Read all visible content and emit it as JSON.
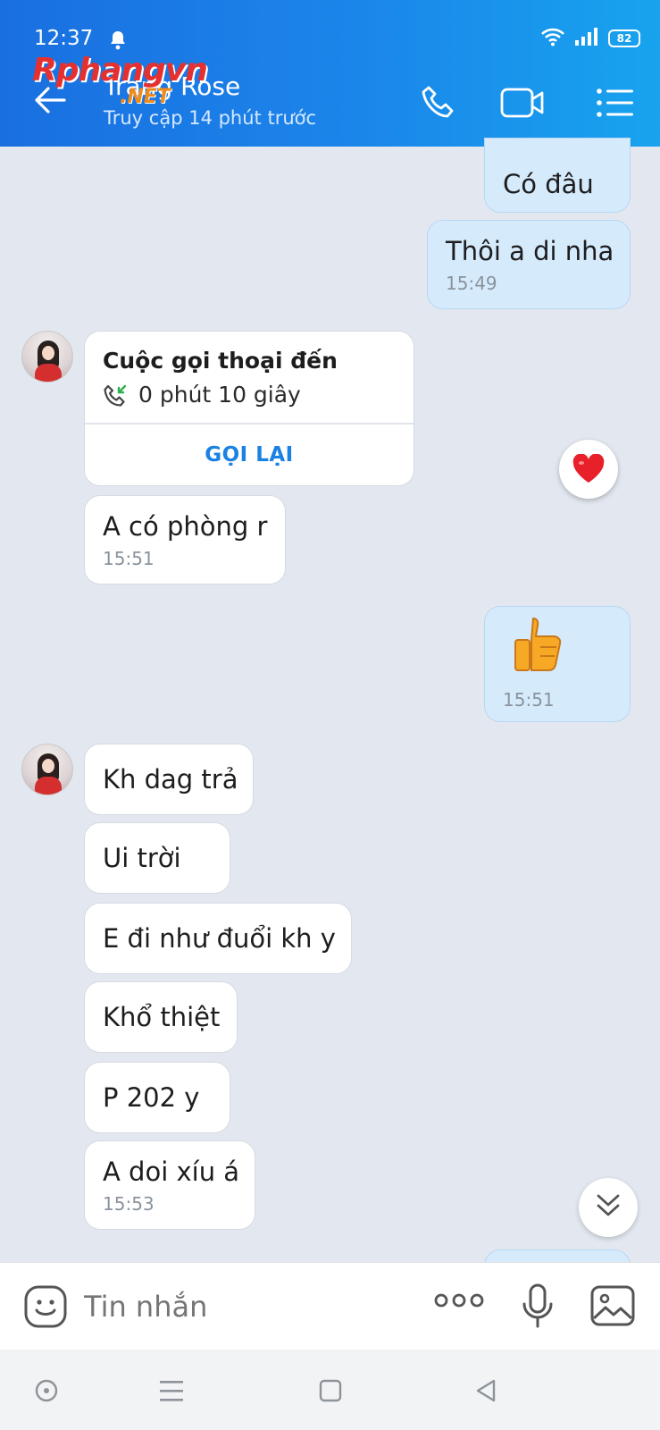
{
  "status_bar": {
    "time": "12:37",
    "battery": "82"
  },
  "header": {
    "contact_name": "Trang Rose",
    "last_seen": "Truy cập 14 phút trước",
    "watermark": "Rphangvn",
    "watermark_sub": ".NET",
    "colors": {
      "gradient_start": "#1a6fe0",
      "gradient_end": "#17a3ee"
    }
  },
  "messages": [
    {
      "sender": "me",
      "text": "Có đâu"
    },
    {
      "sender": "me",
      "text": "Thôi a di nha",
      "time": "15:49"
    },
    {
      "sender": "them",
      "type": "call",
      "title": "Cuộc gọi thoại đến",
      "duration": "0 phút 10 giây",
      "action": "GỌI LẠI",
      "reaction": "heart"
    },
    {
      "sender": "them",
      "text": "A có phòng r",
      "time": "15:51"
    },
    {
      "sender": "me",
      "type": "sticker",
      "sticker": "thumbs-up",
      "time": "15:51"
    },
    {
      "sender": "them",
      "text": "Kh dag trả"
    },
    {
      "sender": "them",
      "text": "Ui trời"
    },
    {
      "sender": "them",
      "text": "E đi như đuổi kh y"
    },
    {
      "sender": "them",
      "text": "Khổ thiệt"
    },
    {
      "sender": "them",
      "text": "P 202 y"
    },
    {
      "sender": "them",
      "text": "A doi xíu á",
      "time": "15:53"
    }
  ],
  "composer": {
    "placeholder": "Tin nhắn"
  },
  "icons": {
    "header": [
      "back-arrow-icon",
      "phone-icon",
      "video-camera-icon",
      "menu-list-icon"
    ],
    "composer": [
      "emoji-icon",
      "more-dots-icon",
      "microphone-icon",
      "image-icon"
    ],
    "nav": [
      "dot-icon",
      "recents-icon",
      "home-icon",
      "back-triangle-icon"
    ]
  },
  "colors": {
    "chat_bg": "#e3e8f0",
    "my_bubble": "#d5ebfc",
    "their_bubble": "#ffffff",
    "accent": "#1a82e2"
  }
}
